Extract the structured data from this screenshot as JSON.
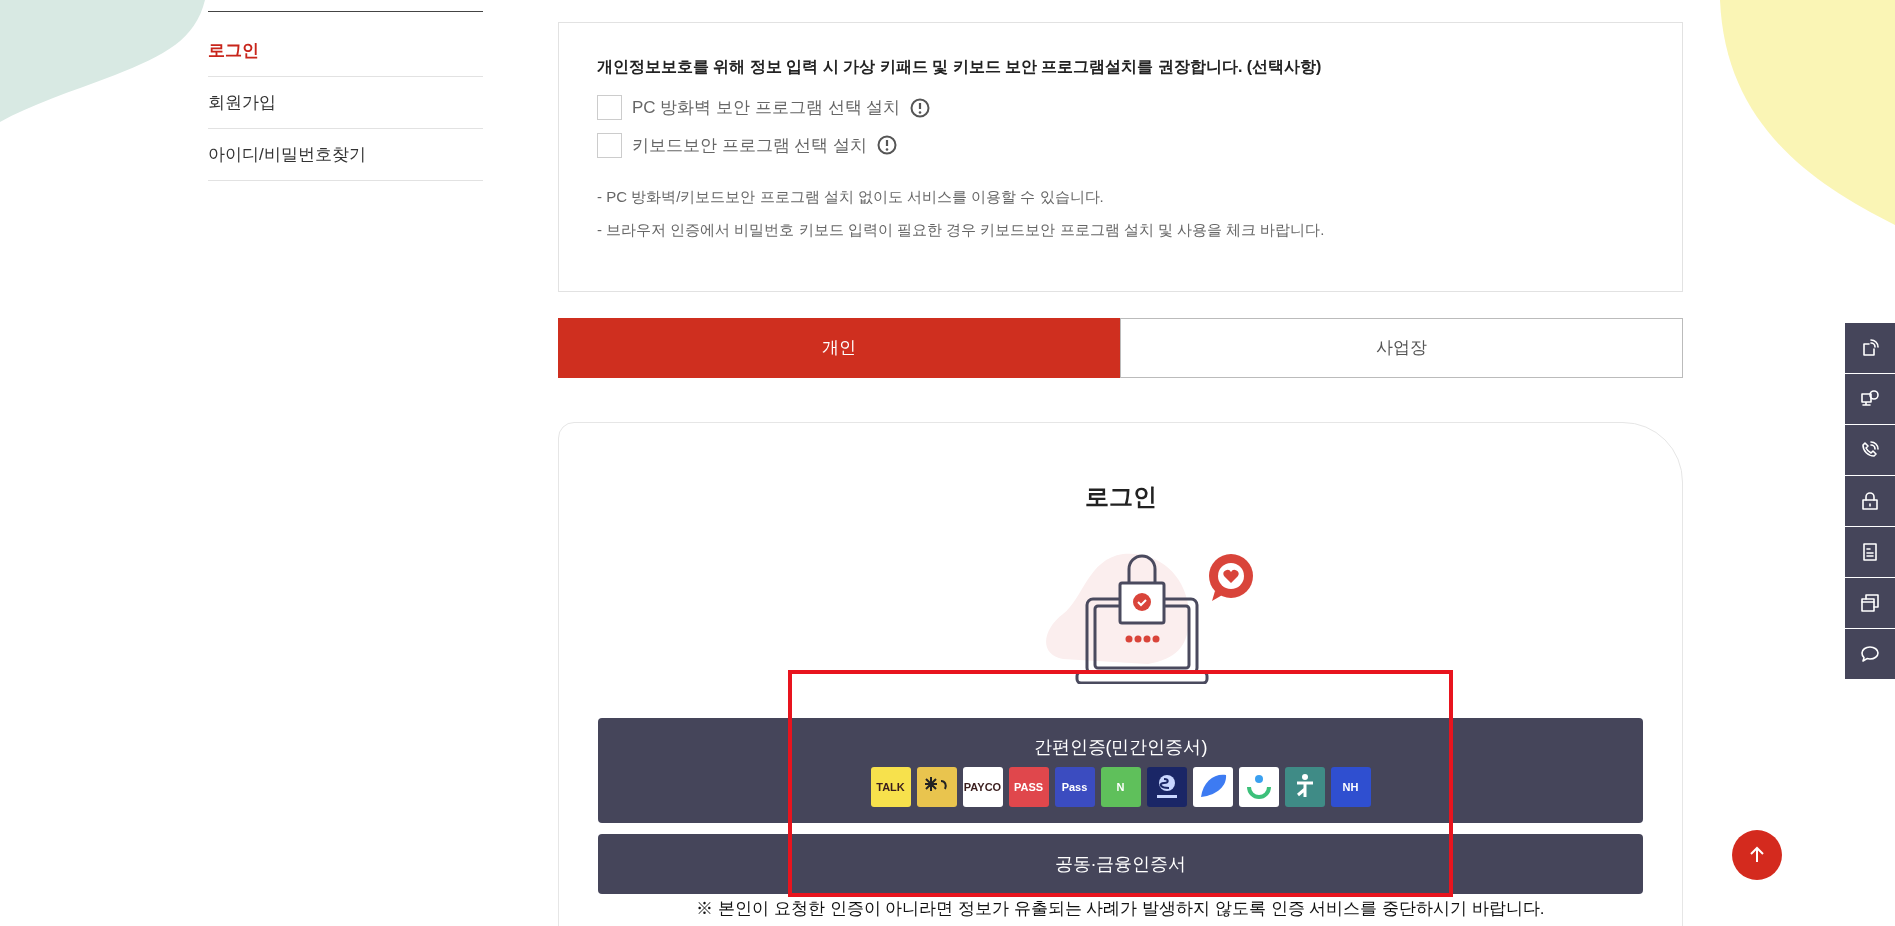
{
  "sidebar": {
    "items": [
      {
        "label": "로그인",
        "selected": true
      },
      {
        "label": "회원가입",
        "selected": false
      },
      {
        "label": "아이디/비밀번호찾기",
        "selected": false
      }
    ]
  },
  "notice": {
    "heading": "개인정보보호를 위해 정보 입력 시 가상 키패드 및 키보드 보안 프로그램설치를 권장합니다. (선택사항)",
    "options": [
      {
        "label": "PC 방화벽 보안 프로그램 선택 설치",
        "checked": false
      },
      {
        "label": "키보드보안 프로그램 선택 설치",
        "checked": false
      }
    ],
    "notes": [
      "-  PC 방화벽/키보드보안 프로그램 설치 없이도 서비스를 이용할 수 있습니다.",
      "-  브라우저 인증에서 비밀번호 키보드 입력이 필요한 경우 키보드보안 프로그램 설치 및 사용을 체크 바랍니다."
    ]
  },
  "tabs": [
    {
      "label": "개인",
      "selected": true
    },
    {
      "label": "사업장",
      "selected": false
    }
  ],
  "login": {
    "title": "로그인",
    "simple_auth": {
      "label": "간편인증(민간인증서)",
      "logos": [
        {
          "kind": "text",
          "label": "TALK",
          "color": "#f7e14c"
        },
        {
          "kind": "star",
          "color": "#e9c44e"
        },
        {
          "kind": "text",
          "label": "PAYCO",
          "color": "#ffffff"
        },
        {
          "kind": "text",
          "label": "PASS",
          "color": "#e0474c"
        },
        {
          "kind": "text",
          "label": "Pass",
          "color": "#3b4cc0"
        },
        {
          "kind": "text",
          "label": "N",
          "color": "#5fc05b"
        },
        {
          "kind": "seal",
          "color": "#1a2666"
        },
        {
          "kind": "swoosh",
          "color": "#ffffff"
        },
        {
          "kind": "smile",
          "color": "#ffffff"
        },
        {
          "kind": "figure",
          "color": "#3f8b86"
        },
        {
          "kind": "text",
          "label": "NH",
          "color": "#2f4fd0"
        }
      ]
    },
    "cert_button": "공동·금융인증서",
    "warning": "※ 본인이 요청한 인증이 아니라면 정보가 유출되는 사례가 발생하지 않도록 인증 서비스를 중단하시기 바랍니다."
  }
}
